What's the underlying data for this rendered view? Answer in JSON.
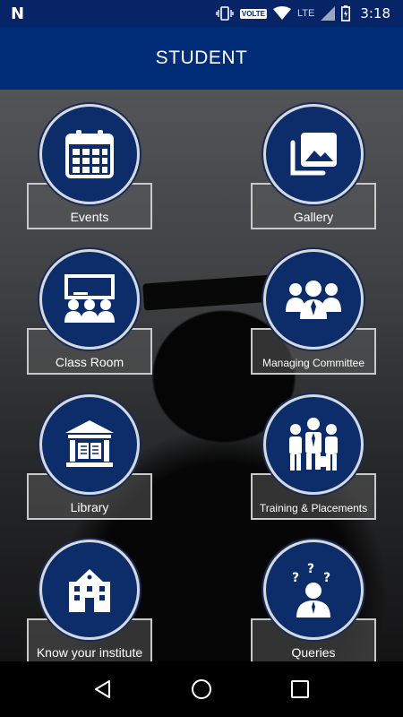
{
  "status_bar": {
    "network_badge": "VOLTE",
    "network_type": "LTE",
    "time": "3:18"
  },
  "app_bar": {
    "title": "STUDENT"
  },
  "tiles": [
    {
      "label": "Events",
      "icon": "calendar-icon"
    },
    {
      "label": "Gallery",
      "icon": "gallery-icon"
    },
    {
      "label": "Class Room",
      "icon": "classroom-icon"
    },
    {
      "label": "Managing Committee",
      "icon": "committee-icon"
    },
    {
      "label": "Library",
      "icon": "library-icon"
    },
    {
      "label": "Training & Placements",
      "icon": "training-icon"
    },
    {
      "label": "Know your institute",
      "icon": "institute-icon"
    },
    {
      "label": "Queries",
      "icon": "queries-icon"
    }
  ],
  "colors": {
    "status_bar": "#062466",
    "app_bar": "#002c78",
    "tile_circle": "#0c2d69"
  },
  "nav_bar": {
    "back_icon": "back-triangle-icon",
    "home_icon": "home-circle-icon",
    "recents_icon": "recents-square-icon"
  }
}
